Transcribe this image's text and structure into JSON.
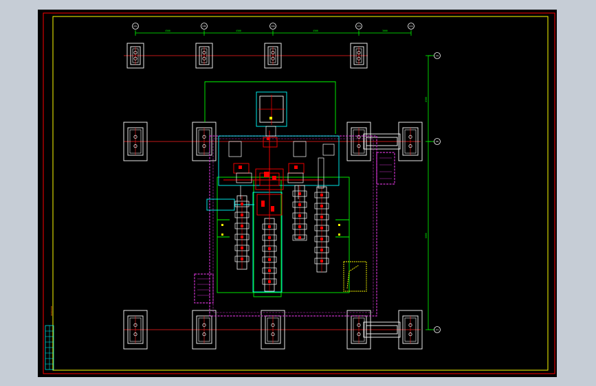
{
  "window": {
    "background": "#c6cdd6",
    "canvas_color": "#000000"
  },
  "colors": {
    "frame_outer": "#ff0000",
    "frame_inner": "#ffff00",
    "grid_line": "#ff2020",
    "dim_line": "#00ff00",
    "pad": "#ffffff",
    "footprint": "#cc33cc",
    "equipment_cyan": "#00ffff",
    "equipment_red": "#ff0000",
    "equipment_white": "#ffffff",
    "equipment_yellow": "#ffff00"
  },
  "axes": {
    "top": [
      "(21)",
      "(18)",
      "(16)",
      "(13)",
      "(11)"
    ],
    "right": [
      "(A)",
      "(B)",
      "(C)"
    ]
  },
  "dimensions": {
    "top": [
      "4500",
      "4500",
      "4500",
      "3000"
    ],
    "right": [
      "4500",
      "6000"
    ]
  },
  "title_block": {
    "vertical_note": "XXXXXXXX"
  }
}
